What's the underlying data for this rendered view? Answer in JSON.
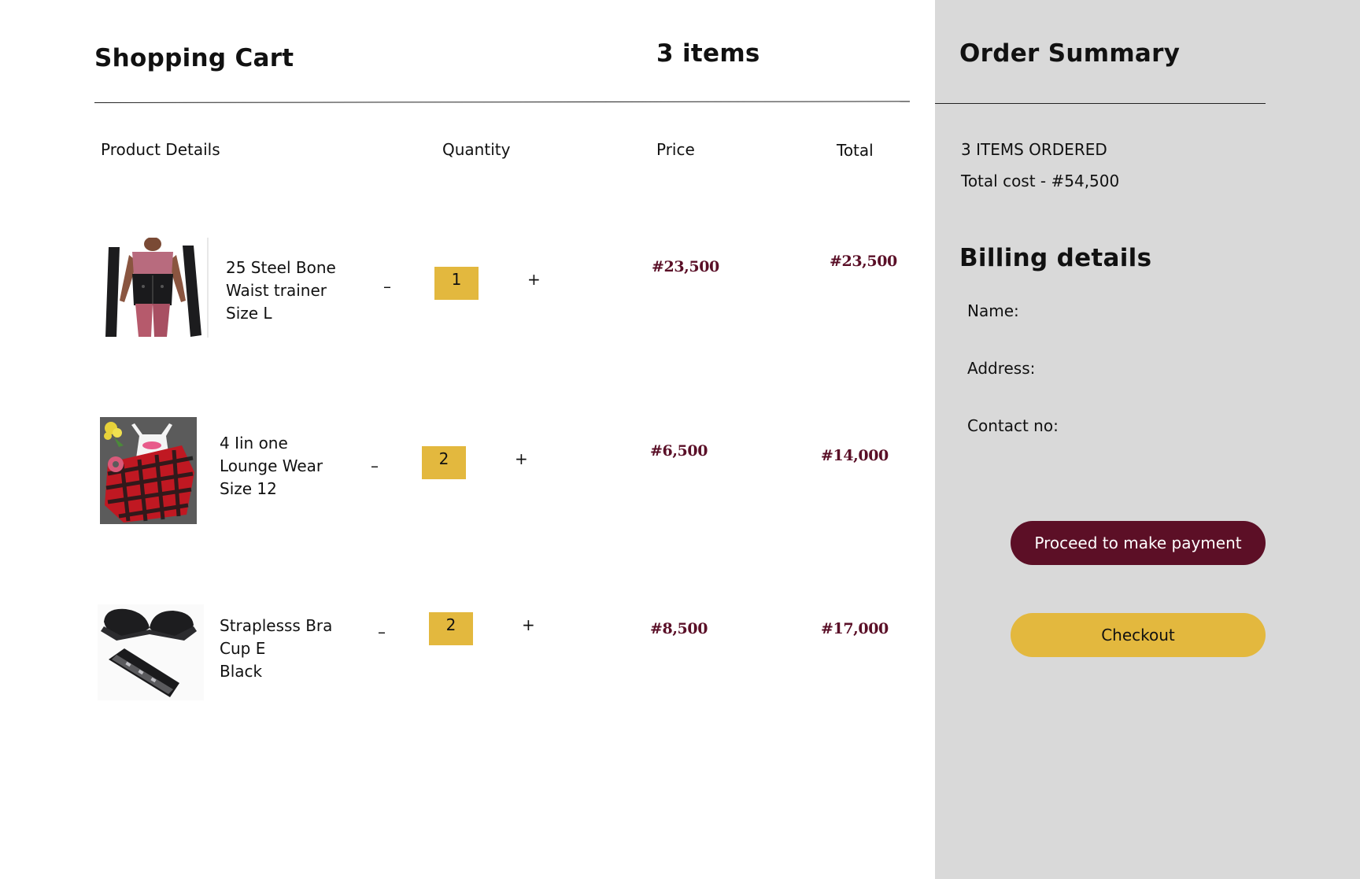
{
  "cart": {
    "title": "Shopping Cart",
    "item_count": "3 items",
    "columns": {
      "product": "Product Details",
      "quantity": "Quantity",
      "price": "Price",
      "total": "Total"
    },
    "decrement_symbol": "–",
    "increment_symbol": "+",
    "items": [
      {
        "name_lines": [
          "25 Steel Bone",
          "Waist trainer",
          "Size L"
        ],
        "quantity": "1",
        "price": "#23,500",
        "total": "#23,500",
        "image_icon": "waist-trainer-photo"
      },
      {
        "name_lines": [
          "4 Iin one",
          "Lounge Wear",
          "Size 12"
        ],
        "quantity": "2",
        "price": "#6,500",
        "total": "#14,000",
        "image_icon": "lounge-wear-photo"
      },
      {
        "name_lines": [
          "Straplesss Bra",
          "Cup E",
          "Black"
        ],
        "quantity": "2",
        "price": "#8,500",
        "total": "#17,000",
        "image_icon": "strapless-bra-photo"
      }
    ]
  },
  "summary": {
    "title": "Order Summary",
    "items_ordered": "3 ITEMS ORDERED",
    "total_cost": "Total cost - #54,500",
    "billing_title": "Billing details",
    "fields": {
      "name": "Name:",
      "address": "Address:",
      "contact": "Contact no:"
    },
    "pay_button": "Proceed to make payment",
    "checkout_button": "Checkout"
  },
  "colors": {
    "accent_gold": "#e3b83e",
    "accent_maroon": "#5c0f26",
    "price_text": "#5a0f27",
    "summary_bg": "#d9d9d9"
  }
}
